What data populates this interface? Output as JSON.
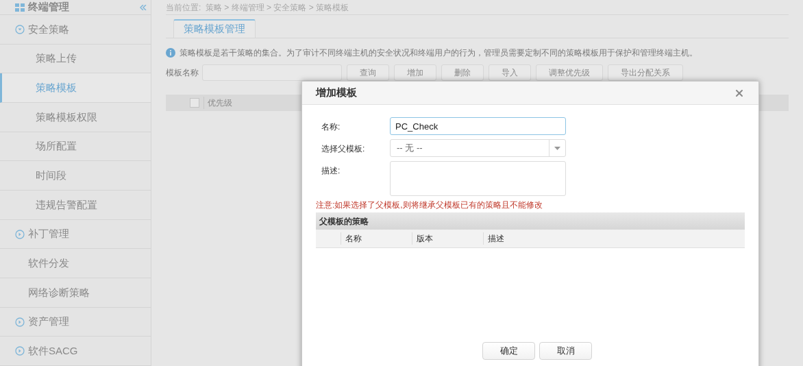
{
  "sidebar": {
    "title": "终端管理",
    "items": [
      {
        "kind": "group",
        "label": "安全策略",
        "expanded": true,
        "selected": false,
        "children": [
          {
            "kind": "sub",
            "label": "策略上传",
            "selected": false
          },
          {
            "kind": "sub",
            "label": "策略模板",
            "selected": true
          },
          {
            "kind": "sub",
            "label": "策略模板权限",
            "selected": false
          },
          {
            "kind": "sub",
            "label": "场所配置",
            "selected": false
          },
          {
            "kind": "sub",
            "label": "时间段",
            "selected": false
          },
          {
            "kind": "sub",
            "label": "违规告警配置",
            "selected": false
          }
        ]
      },
      {
        "kind": "group",
        "label": "补丁管理",
        "expanded": false,
        "selected": false
      },
      {
        "kind": "item",
        "label": "软件分发",
        "selected": false
      },
      {
        "kind": "item",
        "label": "网络诊断策略",
        "selected": false
      },
      {
        "kind": "group",
        "label": "资产管理",
        "expanded": false,
        "selected": false
      },
      {
        "kind": "group",
        "label": "软件SACG",
        "expanded": false,
        "selected": false
      }
    ]
  },
  "breadcrumb": "当前位置:  策略 > 终端管理 > 安全策略 > 策略模板",
  "tabs": [
    {
      "label": "策略模板管理",
      "selected": true
    }
  ],
  "info": "策略模板是若干策略的集合。为了审计不同终端主机的安全状况和终端用户的行为，管理员需要定制不同的策略模板用于保护和管理终端主机。",
  "filter": {
    "label": "模板名称",
    "buttons": [
      "查询",
      "增加",
      "删除",
      "导入",
      "调整优先级",
      "导出分配关系"
    ]
  },
  "table": {
    "select_all": {
      "checked": false
    },
    "columns": [
      "优先级"
    ]
  },
  "dialog": {
    "title": "增加模板",
    "fields": [
      {
        "kind": "input",
        "label": "名称:",
        "value": "PC_Check"
      },
      {
        "kind": "select",
        "label": "选择父模板:",
        "value": "-- 无 --"
      },
      {
        "kind": "textarea",
        "label": "描述:"
      }
    ],
    "warning": "注意:如果选择了父模板,则将继承父模板已有的策略且不能修改",
    "grid": {
      "title": "父模板的策略",
      "columns": [
        "名称",
        "版本",
        "描述"
      ]
    },
    "buttons": [
      "确定",
      "取消"
    ]
  }
}
